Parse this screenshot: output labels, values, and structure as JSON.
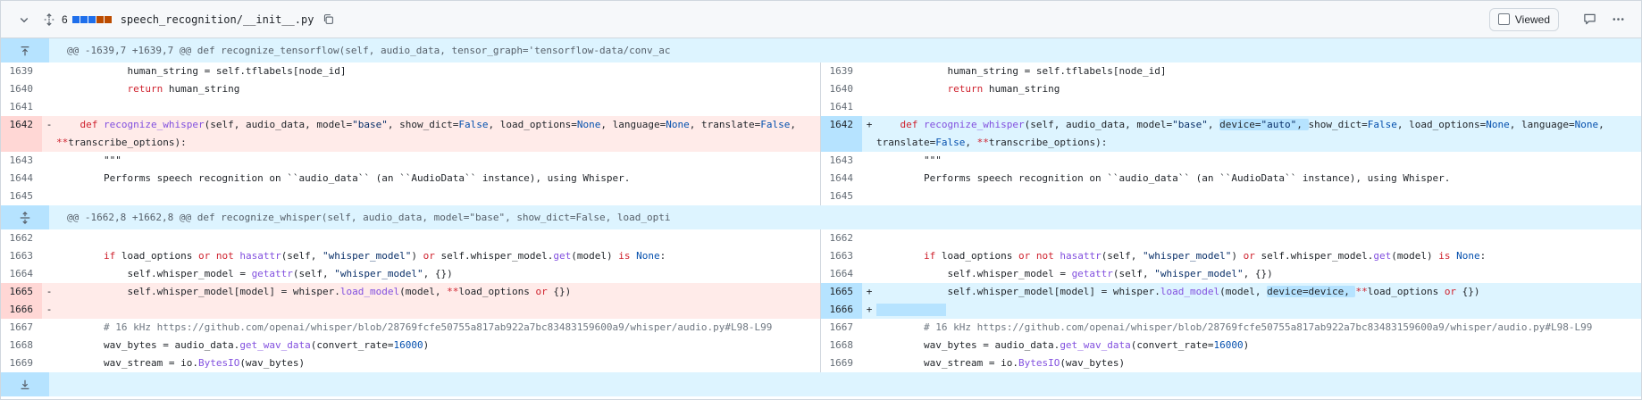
{
  "file": {
    "change_count": "6",
    "path": "speech_recognition/__init__.py",
    "diffstat_colors": [
      "#1f6feb",
      "#1f6feb",
      "#1f6feb",
      "#bc4c00",
      "#bc4c00"
    ],
    "viewed_label": "Viewed"
  },
  "hunks": [
    {
      "header": "@@ -1639,7 +1639,7 @@ def recognize_tensorflow(self, audio_data, tensor_graph='tensorflow-data/conv_ac"
    },
    {
      "header": "@@ -1662,8 +1662,8 @@ def recognize_whisper(self, audio_data, model=\"base\", show_dict=False, load_opti"
    }
  ],
  "lines": {
    "l1639": "1639",
    "l1640": "1640",
    "l1641": "1641",
    "l1642": "1642",
    "l1643": "1643",
    "l1644": "1644",
    "l1645": "1645",
    "l1662": "1662",
    "l1663": "1663",
    "l1664": "1664",
    "l1665": "1665",
    "l1666": "1666",
    "l1667": "1667",
    "l1668": "1668",
    "l1669": "1669"
  },
  "code": {
    "c1639": "            human_string = self.tflabels[node_id]",
    "c1640_kw": "return",
    "c1640_rest": " human_string",
    "c1643": "        \"\"\"",
    "c1644": "        Performs speech recognition on ``audio_data`` (an ``AudioData`` instance), using Whisper.",
    "c1667": "        # 16 kHz https://github.com/openai/whisper/blob/28769fcfe50755a817ab922a7bc83483159600a9/whisper/audio.py#L98-L99",
    "c1668_a": "        wav_bytes = audio_data.",
    "c1668_fn": "get_wav_data",
    "c1668_b": "(convert_rate=",
    "c1668_n": "16000",
    "c1668_c": ")",
    "c1669_a": "        wav_stream = io.",
    "c1669_fn": "BytesIO",
    "c1669_b": "(wav_bytes)"
  },
  "markers": {
    "del": "-",
    "add": "+"
  }
}
